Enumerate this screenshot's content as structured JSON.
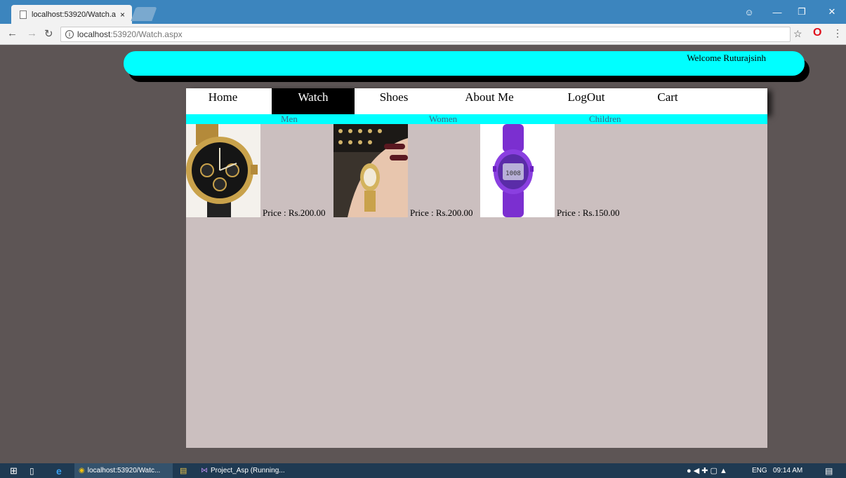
{
  "browser": {
    "tab_title": "localhost:53920/Watch.a",
    "url_host": "localhost",
    "url_rest": ":53920/Watch.aspx",
    "tab_close": "×"
  },
  "site": {
    "welcome": "Welcome Ruturajsinh",
    "menu": [
      "Home",
      "Watch",
      "Shoes",
      "About Me",
      "LogOut",
      "Cart"
    ],
    "active_menu": "Watch",
    "submenu": [
      "Men",
      "Women",
      "Children"
    ],
    "products": [
      {
        "price": "Price : Rs.200.00",
        "image": "gold-black-chronograph-watch"
      },
      {
        "price": "Price : Rs.200.00",
        "image": "gold-ladies-wristwatch"
      },
      {
        "price": "Price : Rs.150.00",
        "image": "purple-digital-kids-watch"
      }
    ],
    "colors": {
      "header": "#00ffff",
      "content_bg": "#cbbfbf",
      "page_bg": "#5d5555"
    }
  },
  "taskbar": {
    "chrome_item": "localhost:53920/Watc...",
    "vs_item": "Project_Asp (Running...",
    "lang": "ENG",
    "time": "09:14 AM"
  }
}
